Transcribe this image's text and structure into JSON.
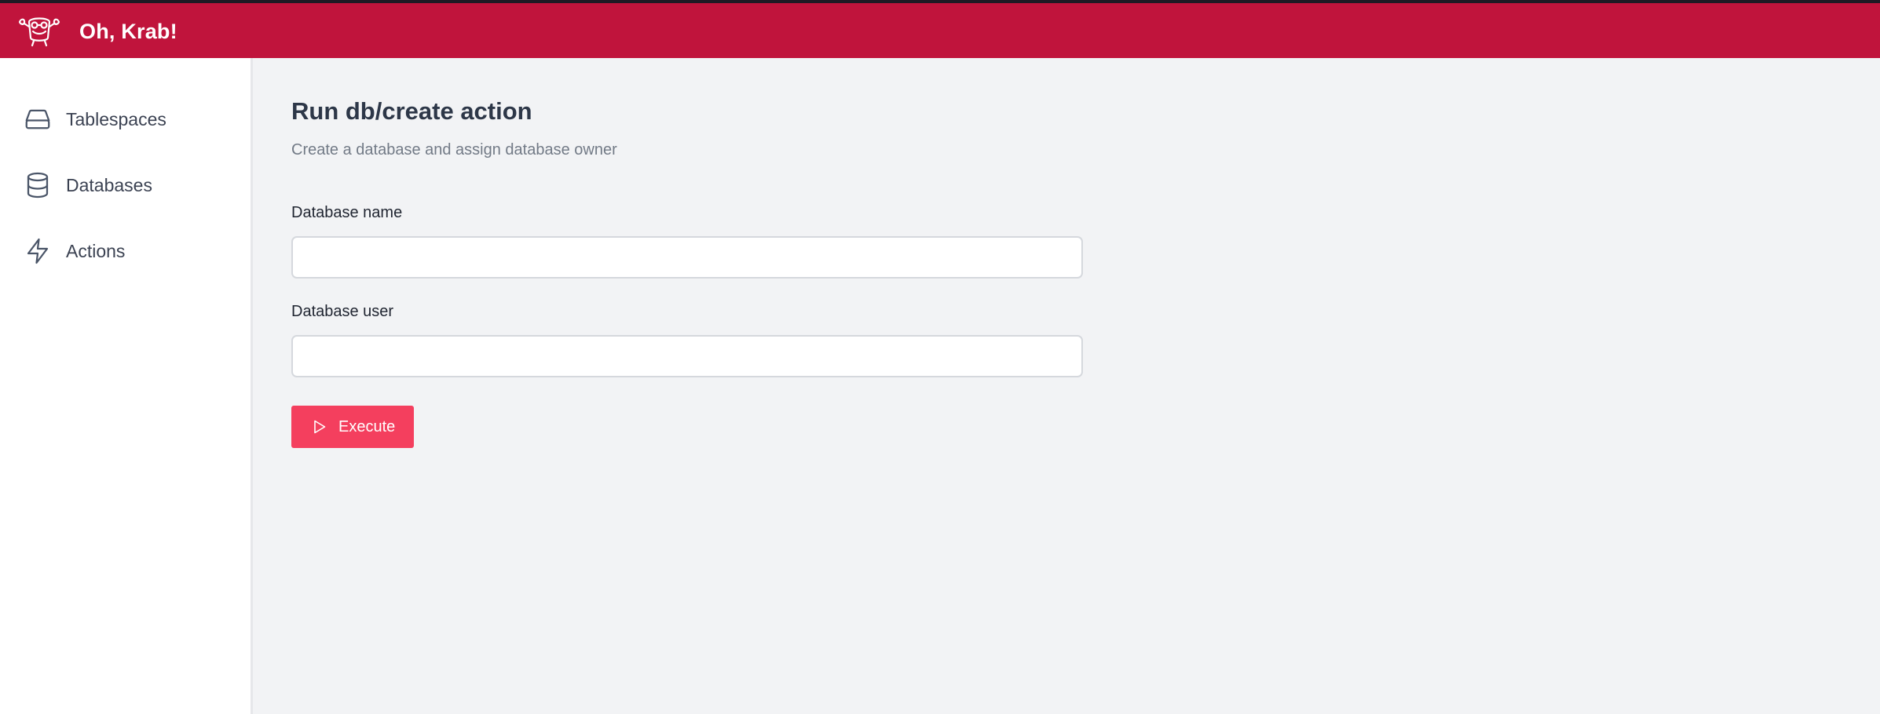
{
  "app": {
    "title": "Oh, Krab!",
    "logo_icon": "crab-logo-icon",
    "brand_color": "#c0143c"
  },
  "sidebar": {
    "items": [
      {
        "label": "Tablespaces",
        "icon": "hard-drive-icon"
      },
      {
        "label": "Databases",
        "icon": "database-icon"
      },
      {
        "label": "Actions",
        "icon": "lightning-icon"
      }
    ]
  },
  "main": {
    "title": "Run db/create action",
    "subtitle": "Create a database and assign database owner",
    "fields": [
      {
        "label": "Database name",
        "value": "",
        "placeholder": ""
      },
      {
        "label": "Database user",
        "value": "",
        "placeholder": ""
      }
    ],
    "execute_button": {
      "label": "Execute",
      "icon": "play-icon",
      "color": "#f43f5e"
    }
  }
}
